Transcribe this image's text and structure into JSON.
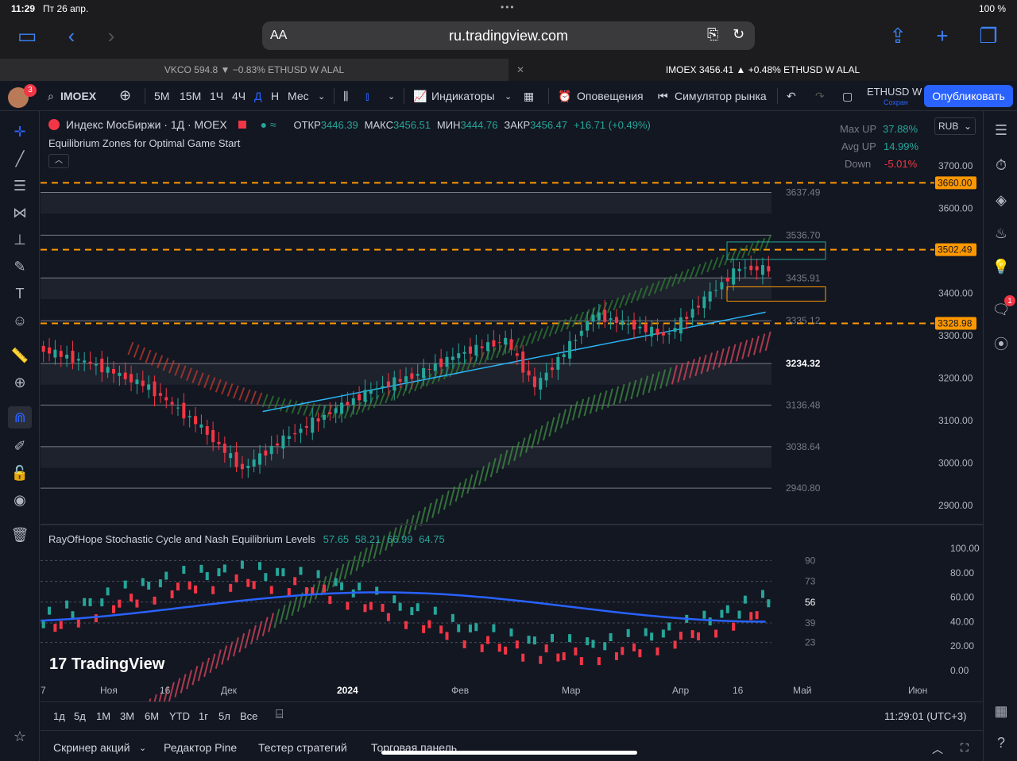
{
  "status": {
    "time": "11:29",
    "date": "Пт 26 апр.",
    "battery": "100 %"
  },
  "safari": {
    "aa": "AA",
    "url": "ru.tradingview.com"
  },
  "tabs": [
    {
      "label": "VKCO 594.8 ▼ −0.83% ETHUSD W ALAL"
    },
    {
      "label": "IMOEX 3456.41 ▲ +0.48% ETHUSD W ALAL"
    }
  ],
  "toolbar": {
    "badge": "3",
    "symbol": "IMOEX",
    "intervals": [
      "5М",
      "15М",
      "1Ч",
      "4Ч",
      "Д",
      "Н",
      "Мес"
    ],
    "indicators": "Индикаторы",
    "alerts": "Оповещения",
    "replay": "Симулятор рынка",
    "layout_name": "ETHUSD W",
    "saved": "Сохран",
    "publish": "Опубликовать"
  },
  "legend": {
    "title": "Индекс МосБиржи · 1Д · MOEX",
    "open_label": "ОТКР",
    "open": "3446.39",
    "high_label": "МАКС",
    "high": "3456.51",
    "low_label": "МИН",
    "low": "3444.76",
    "close_label": "ЗАКР",
    "close": "3456.47",
    "change": "+16.71 (+0.49%)",
    "indicator": "Equilibrium Zones for Optimal Game Start"
  },
  "stats": [
    {
      "label": "Max UP",
      "value": "37.88%",
      "color": "#26a69a"
    },
    {
      "label": "Avg UP",
      "value": "14.99%",
      "color": "#26a69a"
    },
    {
      "label": "Down",
      "value": "-5.01%",
      "color": "#f23645"
    }
  ],
  "currency": "RUB",
  "price_axis": [
    "3700.00",
    "3600.00",
    "3400.00",
    "3300.00",
    "3200.00",
    "3100.00",
    "3000.00",
    "2900.00"
  ],
  "price_tags": [
    "3660.00",
    "3502.49",
    "3328.98"
  ],
  "levels": [
    "3637.49",
    "3536.70",
    "3435.91",
    "3335.12",
    "3234.32",
    "3136.48",
    "3038.64",
    "2940.80"
  ],
  "osc": {
    "title": "RayOfHope Stochastic Cycle and Nash Equilibrium Levels",
    "values": [
      "57.65",
      "58.21",
      "66.99",
      "64.75"
    ],
    "axis": [
      "100.00",
      "80.00",
      "60.00",
      "40.00",
      "20.00",
      "0.00"
    ],
    "levels": [
      "90",
      "73",
      "56",
      "39",
      "23"
    ]
  },
  "time_axis": [
    "7",
    "Ноя",
    "16",
    "Дек",
    "2024",
    "Фев",
    "Мар",
    "Апр",
    "16",
    "Май",
    "Июн"
  ],
  "ranges": [
    "1д",
    "5д",
    "1М",
    "3М",
    "6М",
    "YTD",
    "1г",
    "5л",
    "Все"
  ],
  "clock": "11:29:01 (UTC+3)",
  "bottom_tabs": [
    "Скринер акций",
    "Редактор Pine",
    "Тестер стратегий",
    "Торговая панель"
  ],
  "watermark": "TradingView",
  "chart_data": {
    "type": "candlestick",
    "title": "Индекс МосБиржи · 1Д · MOEX",
    "ylim": [
      2880,
      3720
    ],
    "x": [
      "Ноя",
      "16",
      "Дек",
      "2024",
      "Фев",
      "Мар",
      "Апр",
      "16",
      "Май"
    ],
    "close": [
      3260,
      3230,
      3200,
      3090,
      2990,
      3050,
      3120,
      3170,
      3230,
      3220,
      3270,
      3290,
      3350,
      3270,
      3330,
      3300,
      3400,
      3460,
      3456
    ],
    "oscillator": {
      "ylim": [
        0,
        100
      ],
      "levels": [
        90,
        73,
        56,
        39,
        23
      ]
    }
  }
}
